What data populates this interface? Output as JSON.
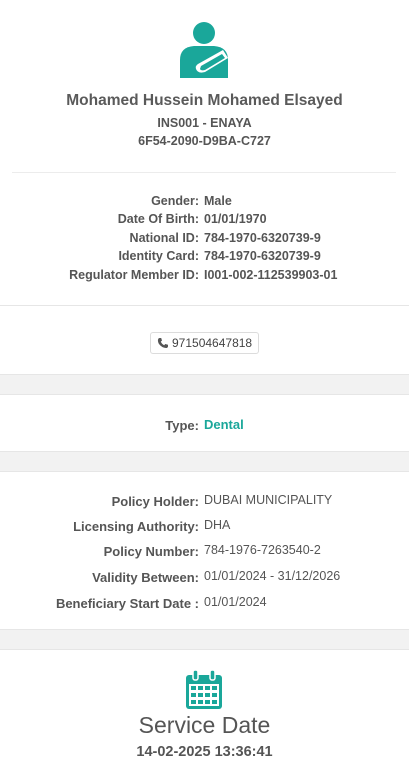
{
  "member": {
    "name": "Mohamed Hussein Mohamed Elsayed",
    "insurer": "INS001 - ENAYA",
    "id": "6F54-2090-D9BA-C727"
  },
  "details": [
    {
      "label": "Gender:",
      "value": "Male"
    },
    {
      "label": "Date Of Birth:",
      "value": "01/01/1970"
    },
    {
      "label": "National ID:",
      "value": "784-1970-6320739-9"
    },
    {
      "label": "Identity Card:",
      "value": "784-1970-6320739-9"
    },
    {
      "label": "Regulator Member ID:",
      "value": "I001-002-112539903-01"
    }
  ],
  "contact": {
    "phone": "971504647818"
  },
  "coverage": {
    "type_label": "Type:",
    "type_value": "Dental"
  },
  "policy": [
    {
      "label": "Policy Holder:",
      "value": "DUBAI MUNICIPALITY"
    },
    {
      "label": "Licensing Authority:",
      "value": "DHA"
    },
    {
      "label": "Policy Number:",
      "value": "784-1976-7263540-2"
    },
    {
      "label": "Validity Between:",
      "value": "01/01/2024 - 31/12/2026"
    },
    {
      "label": "Beneficiary Start Date :",
      "value": "01/01/2024"
    }
  ],
  "service": {
    "title": "Service Date",
    "datetime": "14-02-2025 13:36:41"
  },
  "icons": {
    "avatar": "patient-arm-sling-icon",
    "phone": "phone-icon",
    "calendar": "calendar-icon"
  },
  "colors": {
    "accent": "#1aa79a",
    "text": "#555555",
    "separator": "#f2f2f2"
  }
}
